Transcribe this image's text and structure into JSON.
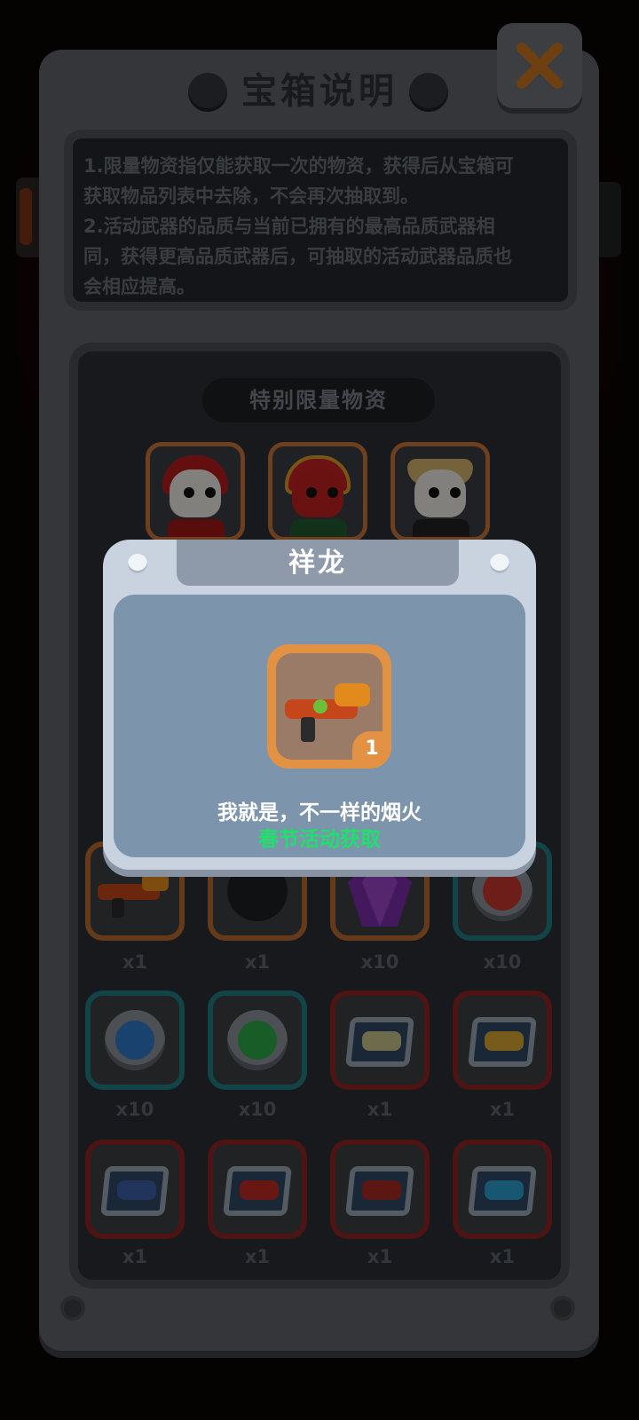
{
  "panel": {
    "title": "宝箱说明",
    "close_icon": "close-x-icon",
    "description_line1": "1.限量物资指仅能获取一次的物资，获得后从宝箱可",
    "description_line2": "获取物品列表中去除，不会再次抽取到。",
    "description_line3": "2.活动武器的品质与当前已拥有的最高品质武器相",
    "description_line4": "同，获得更高品质武器后，可抽取的活动武器品质也",
    "description_line5": "会相应提高。",
    "section_title": "特别限量物资"
  },
  "limited_characters": [
    {
      "icon": "skull-red-hood-character-icon"
    },
    {
      "icon": "red-dragon-hat-character-icon"
    },
    {
      "icon": "skull-straw-hat-character-icon"
    }
  ],
  "rewards": [
    {
      "icon": "dragon-gun-icon",
      "quantity": "x1",
      "badge": "1",
      "frame": "orange"
    },
    {
      "icon": "mystery-item-icon",
      "quantity": "x1",
      "frame": "orange"
    },
    {
      "icon": "purple-crystal-icon",
      "quantity": "x10",
      "frame": "orange"
    },
    {
      "icon": "red-fist-token-icon",
      "quantity": "x10",
      "frame": "teal"
    },
    {
      "icon": "blue-fist-token-icon",
      "quantity": "x10",
      "frame": "teal"
    },
    {
      "icon": "green-fist-token-icon",
      "quantity": "x10",
      "frame": "teal"
    },
    {
      "icon": "blaster-crate-icon",
      "quantity": "x1",
      "frame": "red"
    },
    {
      "icon": "golden-gun-crate-icon",
      "quantity": "x1",
      "frame": "red"
    },
    {
      "icon": "launcher-crate-icon",
      "quantity": "x1",
      "frame": "red"
    },
    {
      "icon": "helmet-crate-icon",
      "quantity": "x1",
      "frame": "red"
    },
    {
      "icon": "armor-crate-icon",
      "quantity": "x1",
      "frame": "red"
    },
    {
      "icon": "goggles-crate-icon",
      "quantity": "x1",
      "frame": "red"
    }
  ],
  "popup": {
    "title": "祥龙",
    "item_icon": "dragon-gun-icon",
    "item_count": "1",
    "description": "我就是，不一样的烟火",
    "source": "春节活动获取"
  },
  "colors": {
    "panel": "#5f6368",
    "close_x": "#c9731f",
    "popup_source_text": "#1ee06a",
    "frame_orange": "#b86a31",
    "frame_teal": "#1f7a82",
    "frame_red": "#8c2524"
  }
}
